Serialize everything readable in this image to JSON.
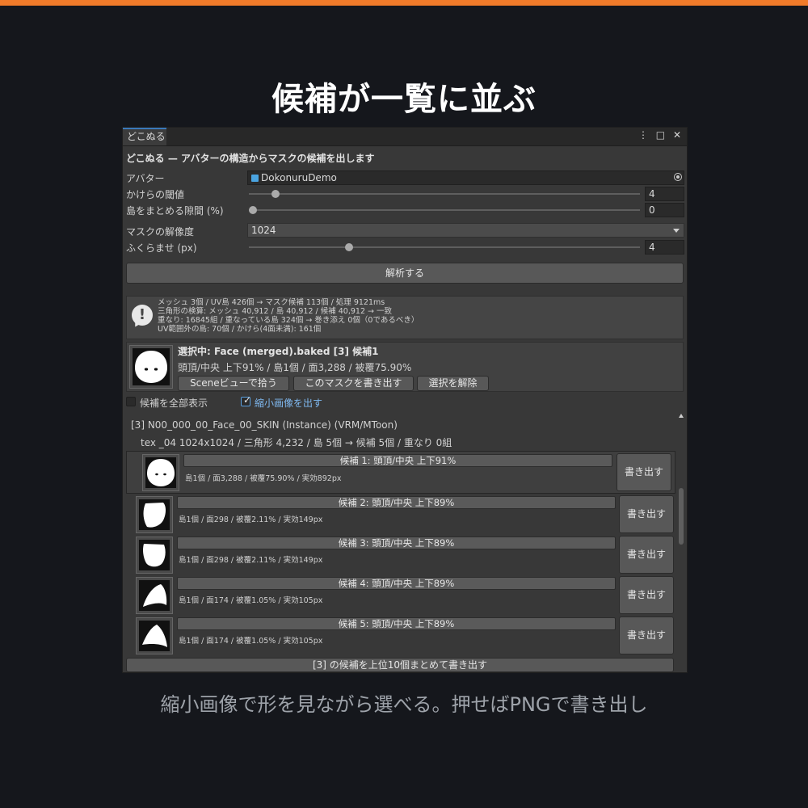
{
  "headline": "候補が一覧に並ぶ",
  "caption": "縮小画像で形を見ながら選べる。押せばPNGで書き出し",
  "window": {
    "tab": "どこぬる",
    "menu_icon": "⋮",
    "maximize_icon": "□",
    "close_icon": "✕",
    "title": "どこぬる — アバターの構造からマスクの候補を出します"
  },
  "form": {
    "avatar_label": "アバター",
    "avatar_value": "DokonuruDemo",
    "gap_threshold_label": "かけらの閾値",
    "gap_threshold_value": "4",
    "gap_threshold_fraction": 0.06,
    "island_gap_label": "島をまとめる隙間 (%)",
    "island_gap_value": "0",
    "island_gap_fraction": 0.0,
    "resolution_label": "マスクの解像度",
    "resolution_value": "1024",
    "dilate_label": "ふくらませ (px)",
    "dilate_value": "4",
    "dilate_fraction": 0.25,
    "analyze_button": "解析する"
  },
  "info": {
    "lines": [
      "メッシュ 3個 / UV島 426個 → マスク候補 113個 / 処理 9121ms",
      "三角形の検算: メッシュ 40,912 / 島 40,912 / 候補 40,912 → 一致",
      "重なり: 16845組 / 重なっている島 324個 → 巻き添え 0個（0であるべき）",
      "UV範囲外の島: 70個 / かけら(4面未満): 161個"
    ]
  },
  "selection": {
    "title": "選択中: Face (merged).baked [3] 候補1",
    "subtitle": "頭頂/中央 上下91% / 島1個 / 面3,288 / 被覆75.90%",
    "pick_in_scene": "Sceneビューで拾う",
    "export_mask": "このマスクを書き出す",
    "deselect": "選択を解除"
  },
  "toggles": {
    "show_all": "候補を全部表示",
    "show_all_checked": false,
    "thumbnails": "縮小画像を出す",
    "thumbnails_checked": true
  },
  "mesh": {
    "header": "[3] N00_000_00_Face_00_SKIN (Instance)  (VRM/MToon)",
    "details": "tex _04 1024x1024 / 三角形 4,232 / 島 5個 → 候補 5個 / 重なり 0組"
  },
  "candidates": [
    {
      "title": "候補 1: 頭頂/中央 上下91%",
      "stats": "島1個 / 面3,288 / 被覆75.90% / 実効892px",
      "export": "書き出す"
    },
    {
      "title": "候補 2: 頭頂/中央 上下89%",
      "stats": "島1個 / 面298 / 被覆2.11% / 実効149px",
      "export": "書き出す"
    },
    {
      "title": "候補 3: 頭頂/中央 上下89%",
      "stats": "島1個 / 面298 / 被覆2.11% / 実効149px",
      "export": "書き出す"
    },
    {
      "title": "候補 4: 頭頂/中央 上下89%",
      "stats": "島1個 / 面174 / 被覆1.05% / 実効105px",
      "export": "書き出す"
    },
    {
      "title": "候補 5: 頭頂/中央 上下89%",
      "stats": "島1個 / 面174 / 被覆1.05% / 実効105px",
      "export": "書き出す"
    }
  ],
  "bulk_export": "[3] の候補を上位10個まとめて書き出す",
  "colors": {
    "accent_bar": "#f07b2a",
    "tab_highlight": "#3a79bb"
  }
}
